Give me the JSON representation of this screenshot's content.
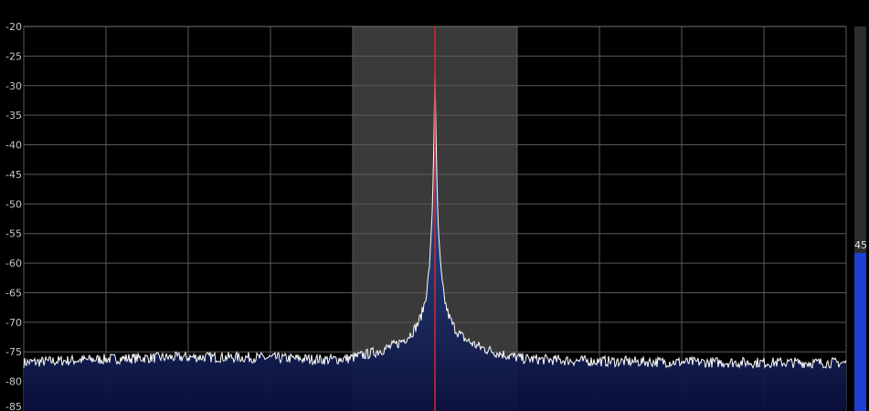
{
  "spectrum": {
    "y_axis": {
      "ticks": [
        "-20",
        "-25",
        "-30",
        "-35",
        "-40",
        "-45",
        "-50",
        "-55",
        "-60",
        "-65",
        "-70",
        "-75",
        "-80",
        "-85"
      ],
      "min": -85,
      "max": -20
    },
    "noise_floor_db": -77,
    "peak_db": -30.5,
    "filter_passband": {
      "start_fraction": 0.4,
      "end_fraction": 0.6
    },
    "tuned_frequency_fraction": 0.5
  },
  "level_bar": {
    "label": "45",
    "level_fraction": 0.41
  },
  "colors": {
    "background": "#000000",
    "grid": "#5a5a5a",
    "passband": "#3a3a3a",
    "trace": "#ffffff",
    "fill_top": "#3f6cb5",
    "fill_bottom": "#0a0f3c",
    "tuning_line": "#d42a2a",
    "level_bar": "#1f3fd2"
  }
}
